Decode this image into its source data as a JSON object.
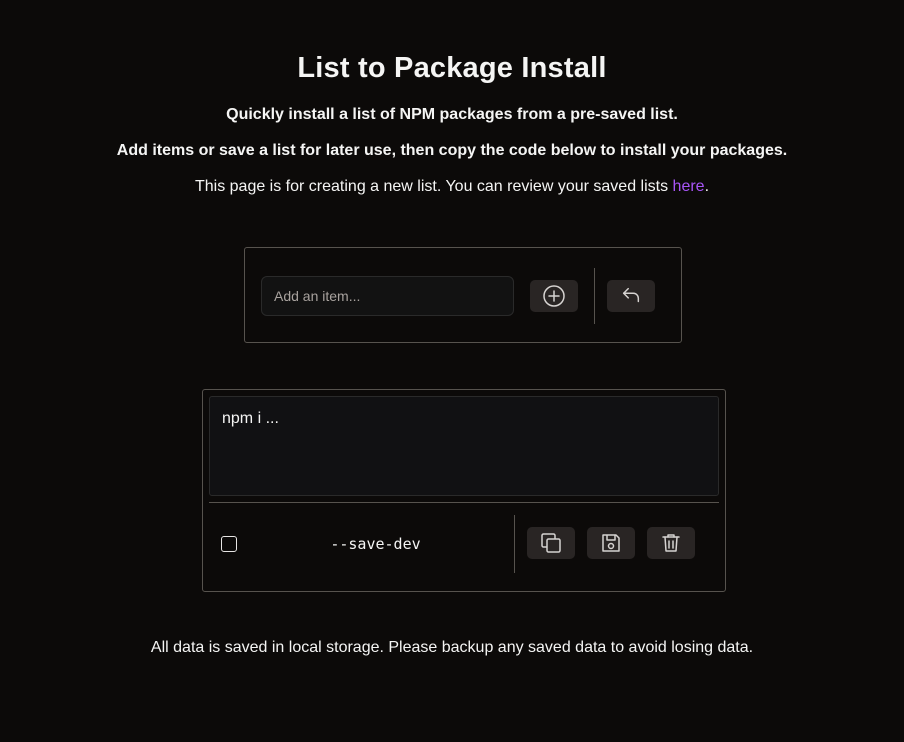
{
  "header": {
    "title": "List to Package Install",
    "tagline": "Quickly install a list of NPM packages from a pre-saved list.",
    "instructions": "Add items or save a list for later use, then copy the code below to install your packages.",
    "note_prefix": "This page is for creating a new list. You can review your saved lists ",
    "note_link": "here",
    "note_suffix": "."
  },
  "add_item": {
    "placeholder": "Add an item...",
    "value": "",
    "add_icon": "plus-circle-icon",
    "undo_icon": "undo-icon"
  },
  "command": {
    "text": "npm i ...",
    "save_dev_checked": false,
    "save_dev_label": "--save-dev",
    "copy_icon": "copy-icon",
    "save_icon": "floppy-disk-icon",
    "delete_icon": "trash-icon"
  },
  "footer": {
    "text": "All data is saved in local storage. Please backup any saved data to avoid losing data."
  },
  "colors": {
    "background": "#0c0a09",
    "accent": "#a855f7",
    "border": "#57534e",
    "button": "#292524"
  }
}
